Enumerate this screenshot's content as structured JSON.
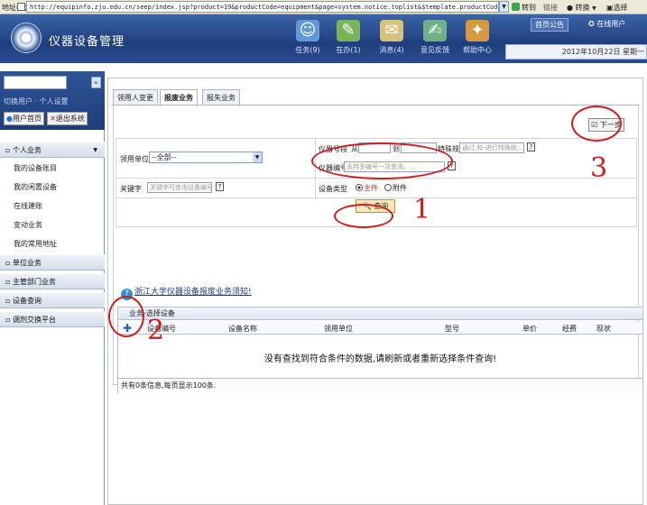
{
  "browser": {
    "address_label": "地址(D)",
    "url": "http://equipinfo.zju.edu.cn/seep/index.jsp?product=19&productCode=equipment&page=system.notice.toplist&$template.productCode=equipment",
    "go_label": "转到",
    "links_label": "链接",
    "convert_label": "转换",
    "select_label": "选择"
  },
  "header": {
    "app_title": "仪器设备管理",
    "nav": [
      {
        "label": "任务(9)",
        "icon": "task-icon"
      },
      {
        "label": "在办(1)",
        "icon": "pending-icon"
      },
      {
        "label": "消息(4)",
        "icon": "message-icon"
      },
      {
        "label": "意见反馈",
        "icon": "feedback-icon"
      },
      {
        "label": "帮助中心",
        "icon": "help-icon"
      }
    ],
    "home_button": "首页公告",
    "online_users": "在线用户",
    "date": "2012年10月22日 星期一"
  },
  "sidebar": {
    "user_line": "切换用户 · 个人设置",
    "btn_home": "用户首页",
    "btn_logout": "退出系统",
    "sections": [
      {
        "label": "个人业务",
        "expanded": true,
        "items": [
          "我的设备账目",
          "我的闲置设备",
          "在线建账",
          "变动业务",
          "我的常用地址"
        ]
      },
      {
        "label": "单位业务",
        "expanded": false
      },
      {
        "label": "主管部门业务",
        "expanded": false
      },
      {
        "label": "设备查询",
        "expanded": false
      },
      {
        "label": "调剂交换平台",
        "expanded": false
      }
    ]
  },
  "tabs": [
    "领用人变更",
    "报废业务",
    "报失业务"
  ],
  "active_tab": "报废业务",
  "next_button": "下一步",
  "form": {
    "unit_label": "领用单位",
    "unit_value": "--全部--",
    "instrument_no_label": "仪器号段",
    "from_label": "从",
    "to_label": "到",
    "special_rule_label": "特殊规则",
    "special_rule_placeholder": "通过,和-进行特殊统…",
    "equip_no_label": "仪器编号",
    "equip_no_placeholder": "支持多编号一次查询，…",
    "keyword_label": "关键字",
    "keyword_placeholder": "关键字可查询设备编号…",
    "equip_type_label": "设备类型",
    "type_main": "主件",
    "type_accessory": "附件",
    "selected_type": "主件",
    "search_button": "查询",
    "help_mark": "?"
  },
  "notice_link": "浙江大学仪器设备报废业务须知!",
  "grid": {
    "title": "业务-选择设备",
    "columns": [
      "设备编号",
      "设备名称",
      "领用单位",
      "型号",
      "单价",
      "经费",
      "现状"
    ],
    "empty_message": "没有查找到符合条件的数据,请刷新或者重新选择条件查询!",
    "footer": "共有0条信息,每页显示100条."
  },
  "annotations": [
    "1",
    "2",
    "3"
  ],
  "colors": {
    "header_blue": "#1f3e7e",
    "annotation_red": "#d21c1c"
  }
}
